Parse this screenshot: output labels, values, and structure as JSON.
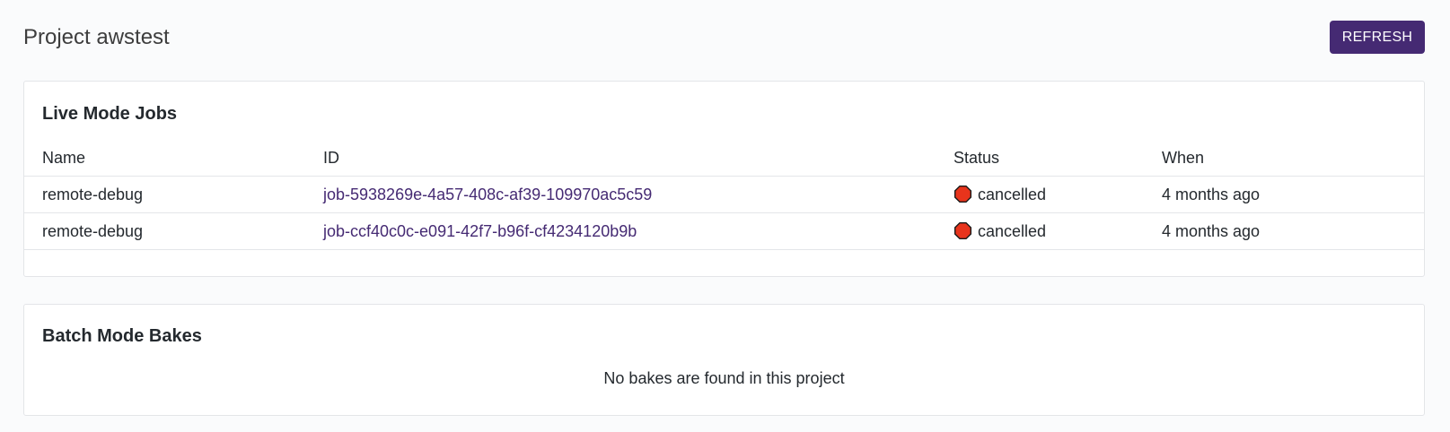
{
  "header": {
    "title": "Project awstest",
    "refresh_label": "REFRESH"
  },
  "live_jobs": {
    "title": "Live Mode Jobs",
    "columns": [
      "Name",
      "ID",
      "Status",
      "When"
    ],
    "rows": [
      {
        "name": "remote-debug",
        "id": "job-5938269e-4a57-408c-af39-109970ac5c59",
        "status": "cancelled",
        "status_icon": "stop-icon",
        "when": "4 months ago"
      },
      {
        "name": "remote-debug",
        "id": "job-ccf40c0c-e091-42f7-b96f-cf4234120b9b",
        "status": "cancelled",
        "status_icon": "stop-icon",
        "when": "4 months ago"
      }
    ]
  },
  "batch_bakes": {
    "title": "Batch Mode Bakes",
    "empty_message": "No bakes are found in this project"
  },
  "colors": {
    "accent": "#452a73",
    "cancelled": "#e8341c",
    "background": "#fafbfc"
  }
}
